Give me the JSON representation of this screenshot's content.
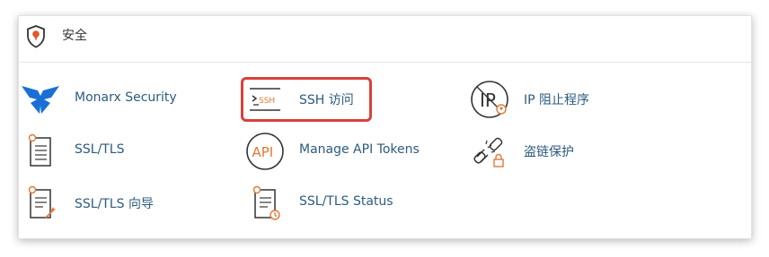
{
  "section": {
    "title": "安全",
    "icon": "shield-pin-icon"
  },
  "items": [
    {
      "label": "Monarx Security",
      "icon": "monarx-butterfly-icon"
    },
    {
      "label": "SSH 访问",
      "icon": "ssh-terminal-icon",
      "icon_text": "SSH"
    },
    {
      "label": "IP 阻止程序",
      "icon": "ip-blocker-icon",
      "icon_text": "IP"
    },
    {
      "label": "SSL/TLS",
      "icon": "certificate-icon"
    },
    {
      "label": "Manage API Tokens",
      "icon": "api-icon",
      "icon_text": "API"
    },
    {
      "label": "盗链保护",
      "icon": "broken-link-lock-icon"
    },
    {
      "label": "SSL/TLS 向导",
      "icon": "certificate-wizard-icon"
    },
    {
      "label": "SSL/TLS Status",
      "icon": "certificate-status-icon"
    }
  ],
  "colors": {
    "accent": "#e0793a",
    "label": "#2c5b7f",
    "icon_dark": "#333333",
    "monarx": "#1a6fd6",
    "highlight_border": "#d9403a"
  }
}
